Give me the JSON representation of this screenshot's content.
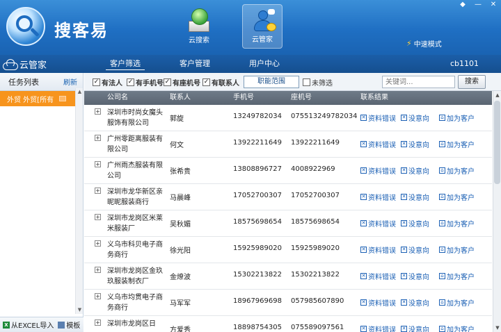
{
  "app": {
    "title": "搜客易"
  },
  "window_controls": {
    "pin": "◆",
    "minimize": "—",
    "close": "✕"
  },
  "nav": [
    {
      "label": "云搜索",
      "icon": "cloud-search-icon",
      "active": false
    },
    {
      "label": "云管家",
      "icon": "cloud-manager-icon",
      "active": true
    }
  ],
  "speed_mode": "中速模式",
  "subbar": {
    "section_label": "云管家",
    "tabs": [
      {
        "label": "客户筛选",
        "active": true
      },
      {
        "label": "客户管理",
        "active": false
      },
      {
        "label": "用户中心",
        "active": false
      }
    ],
    "user_id": "cb1101"
  },
  "sidebar": {
    "title": "任务列表",
    "refresh": "刷新",
    "items": [
      {
        "label": "外贸 外贸[所有"
      }
    ],
    "footer": {
      "import": "从EXCEL导入",
      "template": "模板"
    }
  },
  "filters": {
    "checkboxes": [
      {
        "label": "有法人",
        "checked": true
      },
      {
        "label": "有手机号",
        "checked": true
      },
      {
        "label": "有座机号",
        "checked": true
      },
      {
        "label": "有联系人",
        "checked": true
      }
    ],
    "range_button": "职能范围",
    "unfiltered": {
      "label": "未筛选",
      "checked": false
    },
    "keyword_placeholder": "关键词...",
    "search_button": "搜索"
  },
  "table": {
    "columns": [
      "公司名",
      "联系人",
      "手机号",
      "座机号",
      "联系结果"
    ],
    "actions": [
      "资料错误",
      "没意向",
      "加为客户"
    ],
    "rows": [
      {
        "company": "深圳市时尚女魔头服饰有限公司",
        "contact": "郭旋",
        "mobile": "13249782034",
        "landline": "075513249782034"
      },
      {
        "company": "广州零距离服装有限公司",
        "contact": "何文",
        "mobile": "13922211649",
        "landline": "13922211649"
      },
      {
        "company": "广州雨杰服装有限公司",
        "contact": "张希贵",
        "mobile": "13808896727",
        "landline": "4008922969"
      },
      {
        "company": "深圳市龙华新区亲昵昵服装商行",
        "contact": "马晨峰",
        "mobile": "17052700307",
        "landline": "17052700307"
      },
      {
        "company": "深圳市龙岗区米莱米服装厂",
        "contact": "吴秋媚",
        "mobile": "18575698654",
        "landline": "18575698654"
      },
      {
        "company": "义乌市科贝电子商务商行",
        "contact": "徐光阳",
        "mobile": "15925989020",
        "landline": "15925989020"
      },
      {
        "company": "深圳市龙岗区金玖玖服装制衣厂",
        "contact": "金燎波",
        "mobile": "15302213822",
        "landline": "15302213822"
      },
      {
        "company": "义乌市均贯电子商务商行",
        "contact": "马军军",
        "mobile": "18967969698",
        "landline": "057985607890"
      },
      {
        "company": "深圳市龙岗区日",
        "contact": "方爱秀",
        "mobile": "18898754305",
        "landline": "075589097561"
      }
    ]
  }
}
